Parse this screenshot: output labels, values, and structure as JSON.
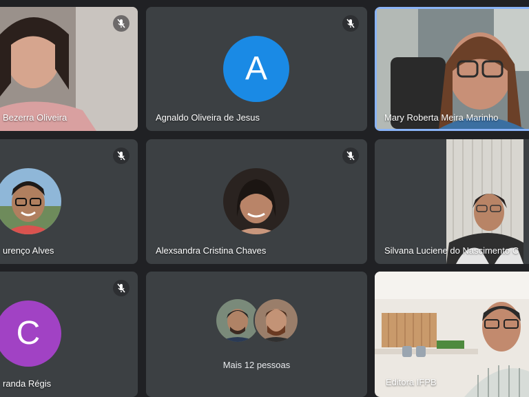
{
  "participants": [
    {
      "name": "Bezerra Oliveira",
      "muted": true
    },
    {
      "name": "Agnaldo Oliveira de Jesus",
      "muted": true,
      "initial": "A",
      "avatar_color": "#1a8ae5"
    },
    {
      "name": "Mary Roberta Meira Marinho",
      "muted": false,
      "active_speaker": true
    },
    {
      "name": "urenço Alves",
      "muted": true
    },
    {
      "name": "Alexsandra Cristina Chaves",
      "muted": true
    },
    {
      "name": "Silvana Luciene do Nascimento C",
      "muted": false
    },
    {
      "name": "randa Régis",
      "muted": true,
      "initial": "C",
      "avatar_color": "#a142c4"
    },
    {
      "name": "Editora IFPB",
      "muted": false
    }
  ],
  "overflow": {
    "label": "Mais 12 pessoas"
  },
  "colors": {
    "background": "#202124",
    "tile": "#3c4043",
    "speaker_border": "#8ab4f8"
  },
  "icons": {
    "mute": "mic-off-icon"
  }
}
